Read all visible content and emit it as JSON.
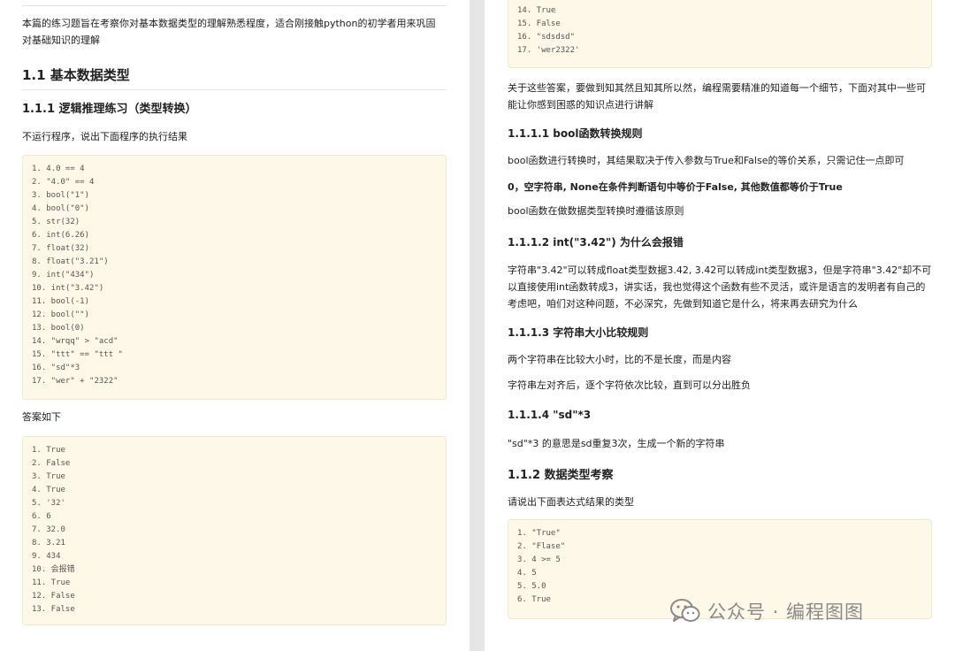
{
  "left": {
    "intro": "本篇的练习题旨在考察你对基本数据类型的理解熟悉程度，适合刚接触python的初学者用来巩固对基础知识的理解",
    "h2": "1.1 基本数据类型",
    "h3": "1.1.1 逻辑推理练习（类型转换）",
    "question": "不运行程序，说出下面程序的执行结果",
    "code1": [
      "1. 4.0 == 4",
      "2. \"4.0\" == 4",
      "3. bool(\"1\")",
      "4. bool(\"0\")",
      "5. str(32)",
      "6. int(6.26)",
      "7. float(32)",
      "8. float(\"3.21\")",
      "9. int(\"434\")",
      "10. int(\"3.42\")",
      "11. bool(-1)",
      "12. bool(\"\")",
      "13. bool(0)",
      "14. \"wrqq\" > \"acd\"",
      "15. \"ttt\" == \"ttt \"",
      "16. \"sd\"*3",
      "17. \"wer\" + \"2322\""
    ],
    "answer_label": "答案如下",
    "code2": [
      "1. True",
      "2. False",
      "3. True",
      "4. True",
      "5. '32'",
      "6. 6",
      "7. 32.0",
      "8. 3.21",
      "9. 434",
      "10. 会报错",
      "11. True",
      "12. False",
      "13. False"
    ]
  },
  "right": {
    "code_top": [
      "14. True",
      "15. False",
      "16. \"sdsdsd\"",
      "17. 'wer2322'"
    ],
    "p1": "关于这些答案，要做到知其然且知其所以然，编程需要精准的知道每一个细节，下面对其中一些可能让你感到困惑的知识点进行讲解",
    "h4_1": "1.1.1.1 bool函数转换规则",
    "p2": "bool函数进行转换时，其结果取决于传入参数与True和False的等价关系，只需记住一点即可",
    "p2_bold": "0，空字符串, None在条件判断语句中等价于False, 其他数值都等价于True",
    "p3": "bool函数在做数据类型转换时遵循该原则",
    "h4_2": "1.1.1.2 int(\"3.42\") 为什么会报错",
    "p4": "字符串\"3.42\"可以转成float类型数据3.42, 3.42可以转成int类型数据3，但是字符串\"3.42\"却不可以直接使用int函数转成3，讲实话，我也觉得这个函数有些不灵活，或许是语言的发明者有自己的考虑吧，咱们对这种问题，不必深究，先做到知道它是什么，将来再去研究为什么",
    "h4_3": "1.1.1.3 字符串大小比较规则",
    "p5": "两个字符串在比较大小时，比的不是长度，而是内容",
    "p6": "字符串左对齐后，逐个字符依次比较，直到可以分出胜负",
    "h4_4": "1.1.1.4 \"sd\"*3",
    "p7": "\"sd\"*3 的意思是sd重复3次，生成一个新的字符串",
    "h3_2": "1.1.2 数据类型考察",
    "p8": "请说出下面表达式结果的类型",
    "code3": [
      "1. \"True\"",
      "2. \"Flase\"",
      "3. 4 >= 5",
      "4. 5",
      "5. 5.0",
      "6. True"
    ]
  },
  "watermark": "公众号 · 编程图图",
  "watermark_icon": "wechat-icon"
}
